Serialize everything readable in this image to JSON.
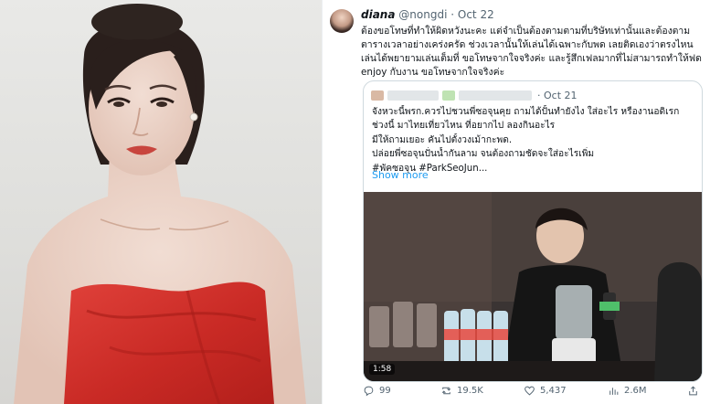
{
  "tweet": {
    "display_name": "diana",
    "handle": "@nongdi",
    "separator": "·",
    "date": "Oct 22",
    "text": "ต้องขอโทษที่ทำให้ผิดหวังนะคะ แต่จำเป็นต้องตามตามที่บริษัทเท่านั้นและต้องตามตารางเวลาอย่างเคร่งครัด ช่วงเวลานั้นให้เล่นได้เฉพาะกับพด เลยติดเองว่าตรงไหนเล่นได้พยายามเล่นเต็มที่ ขอโทษจากใจจริงค่ะ และรู้สึกเฟลมากที่ไม่สามารถทำให้ฟด enjoy กับงาน ขอโทษจากใจจริงค่ะ"
  },
  "quote": {
    "separator": "·",
    "date": "Oct 21",
    "lines": [
      "จังหวะนี้พรก.ควรไปชวนพี่ซอจุนคุย ถามได้ปั้นทำยังไง ใส่อะไร หรืองานอดิเรก",
      "ช่วงนี้ มาไทยเที่ยวไหน ที่อยากไป ลองกินอะไร",
      "มีให้ถามเยอะ คันไปตั้งวงเม้ากะพด.",
      "ปล่อยพี่ซอจุนปั่นน้ำกันลาม จนต้องถามชัดจะใส่อะไรเพิ่ม",
      "#พัคซอจุน #ParkSeoJun..."
    ],
    "show_more": "Show more",
    "video_duration": "1:58"
  },
  "actions": {
    "replies": "99",
    "retweets": "19.5K",
    "likes": "5,437",
    "views": "2.6M"
  },
  "colors": {
    "link_blue": "#1d9bf0",
    "muted_gray": "#536471",
    "text_dark": "#0f1419",
    "dress_red": "#d7302a"
  },
  "icons": [
    "reply-icon",
    "retweet-icon",
    "like-icon",
    "views-icon",
    "share-icon"
  ]
}
